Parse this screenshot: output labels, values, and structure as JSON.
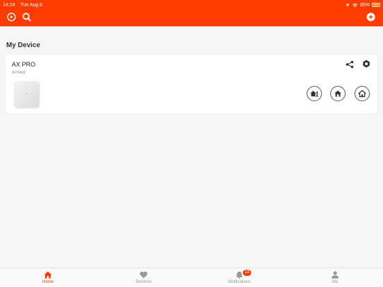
{
  "status_bar": {
    "time": "14:24",
    "date": "Tue Aug 8",
    "battery": "85%"
  },
  "section": {
    "title": "My Device"
  },
  "device": {
    "name": "AX PRO",
    "status": "Armed"
  },
  "tabs": [
    {
      "label": "Home",
      "icon": "home-icon",
      "active": true
    },
    {
      "label": "Services",
      "icon": "heart-icon",
      "active": false
    },
    {
      "label": "Notifications",
      "icon": "bell-icon",
      "active": false,
      "badge": "13"
    },
    {
      "label": "Me",
      "icon": "person-icon",
      "active": false
    }
  ],
  "colors": {
    "accent": "#ff3c00",
    "background": "#f6f6f6"
  }
}
